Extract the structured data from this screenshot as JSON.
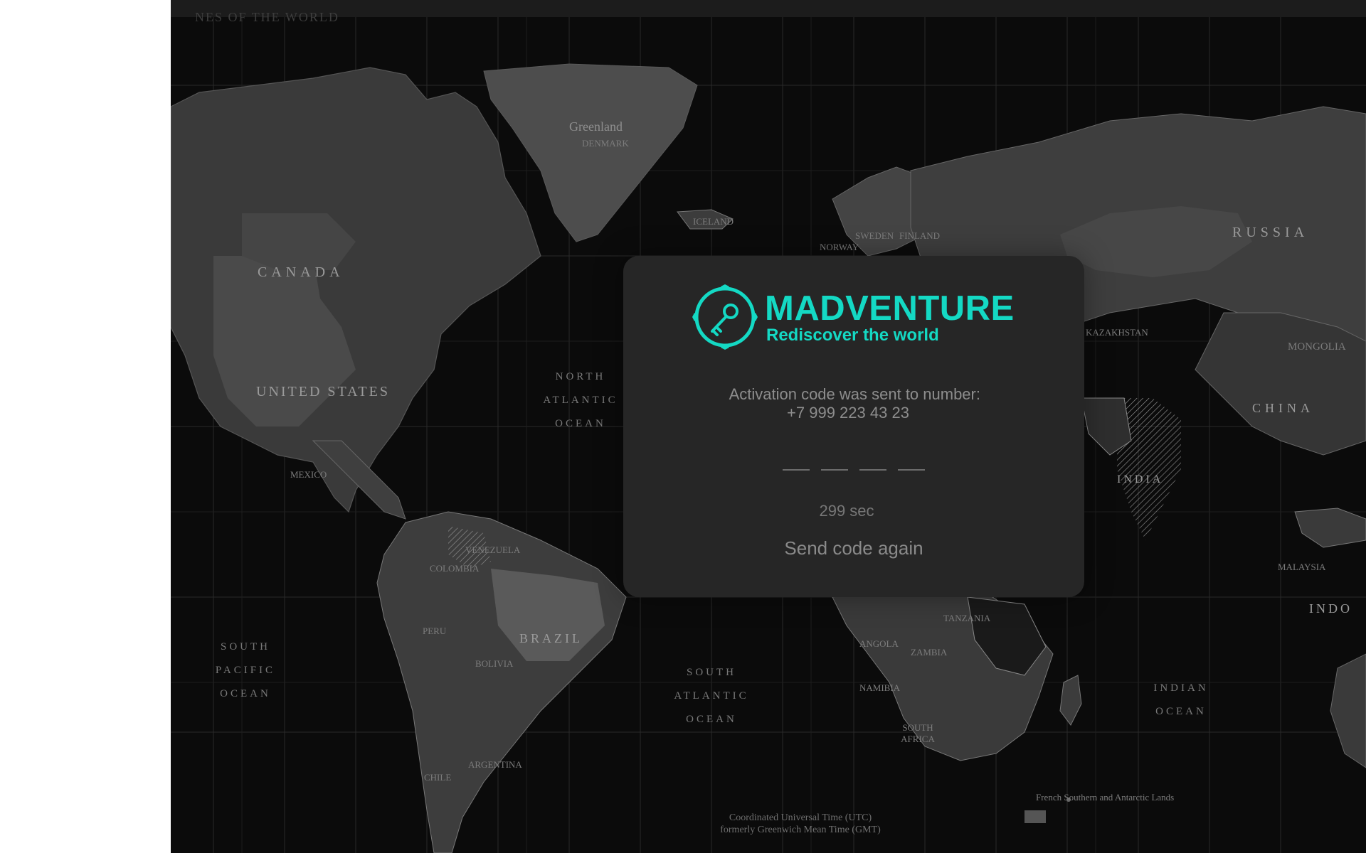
{
  "map": {
    "header_text": "NES OF THE WORLD",
    "labels": {
      "greenland": "Greenland",
      "greenland_sub": "DENMARK",
      "canada": "CANADA",
      "united_states": "UNITED STATES",
      "mexico": "MEXICO",
      "russia": "RUSSIA",
      "china": "CHINA",
      "india": "INDIA",
      "mongolia": "MONGOLIA",
      "kazakhstan": "KAZAKHSTAN",
      "finland": "FINLAND",
      "sweden": "SWEDEN",
      "norway": "NORWAY",
      "iceland": "ICELAND",
      "brazil": "BRAZIL",
      "bolivia": "BOLIVIA",
      "colombia": "COLOMBIA",
      "peru": "PERU",
      "venezuela": "VENEZUELA",
      "argentina": "ARGENTINA",
      "chile": "CHILE",
      "angola": "ANGOLA",
      "namibia": "NAMIBIA",
      "zambia": "ZAMBIA",
      "tanzania": "TANZANIA",
      "malaysia": "MALAYSIA",
      "south_africa": "SOUTH AFRICA",
      "north_atlantic": "NORTH ATLANTIC OCEAN",
      "south_atlantic": "SOUTH ATLANTIC OCEAN",
      "south_pacific": "SOUTH PACIFIC OCEAN",
      "indian_ocean": "INDIAN OCEAN",
      "indo": "INDO",
      "utc_footer": "Coordinated Universal Time (UTC) formerly Greenwich Mean Time (GMT)",
      "french_southern": "French Southern and Antarctic Lands"
    }
  },
  "modal": {
    "brand_name": "MADVENTURE",
    "tagline": "Rediscover the world",
    "sent_message": "Activation code was sent to number:",
    "phone_number": "+7 999 223 43 23",
    "code_slots": [
      "",
      "",
      "",
      ""
    ],
    "timer_text": "299 sec",
    "resend_label": "Send code again"
  },
  "colors": {
    "brand_accent": "#14d9c4",
    "modal_background": "#262626",
    "map_background": "#0b0b0b"
  },
  "icons": {
    "logo": "compass-key-icon"
  }
}
